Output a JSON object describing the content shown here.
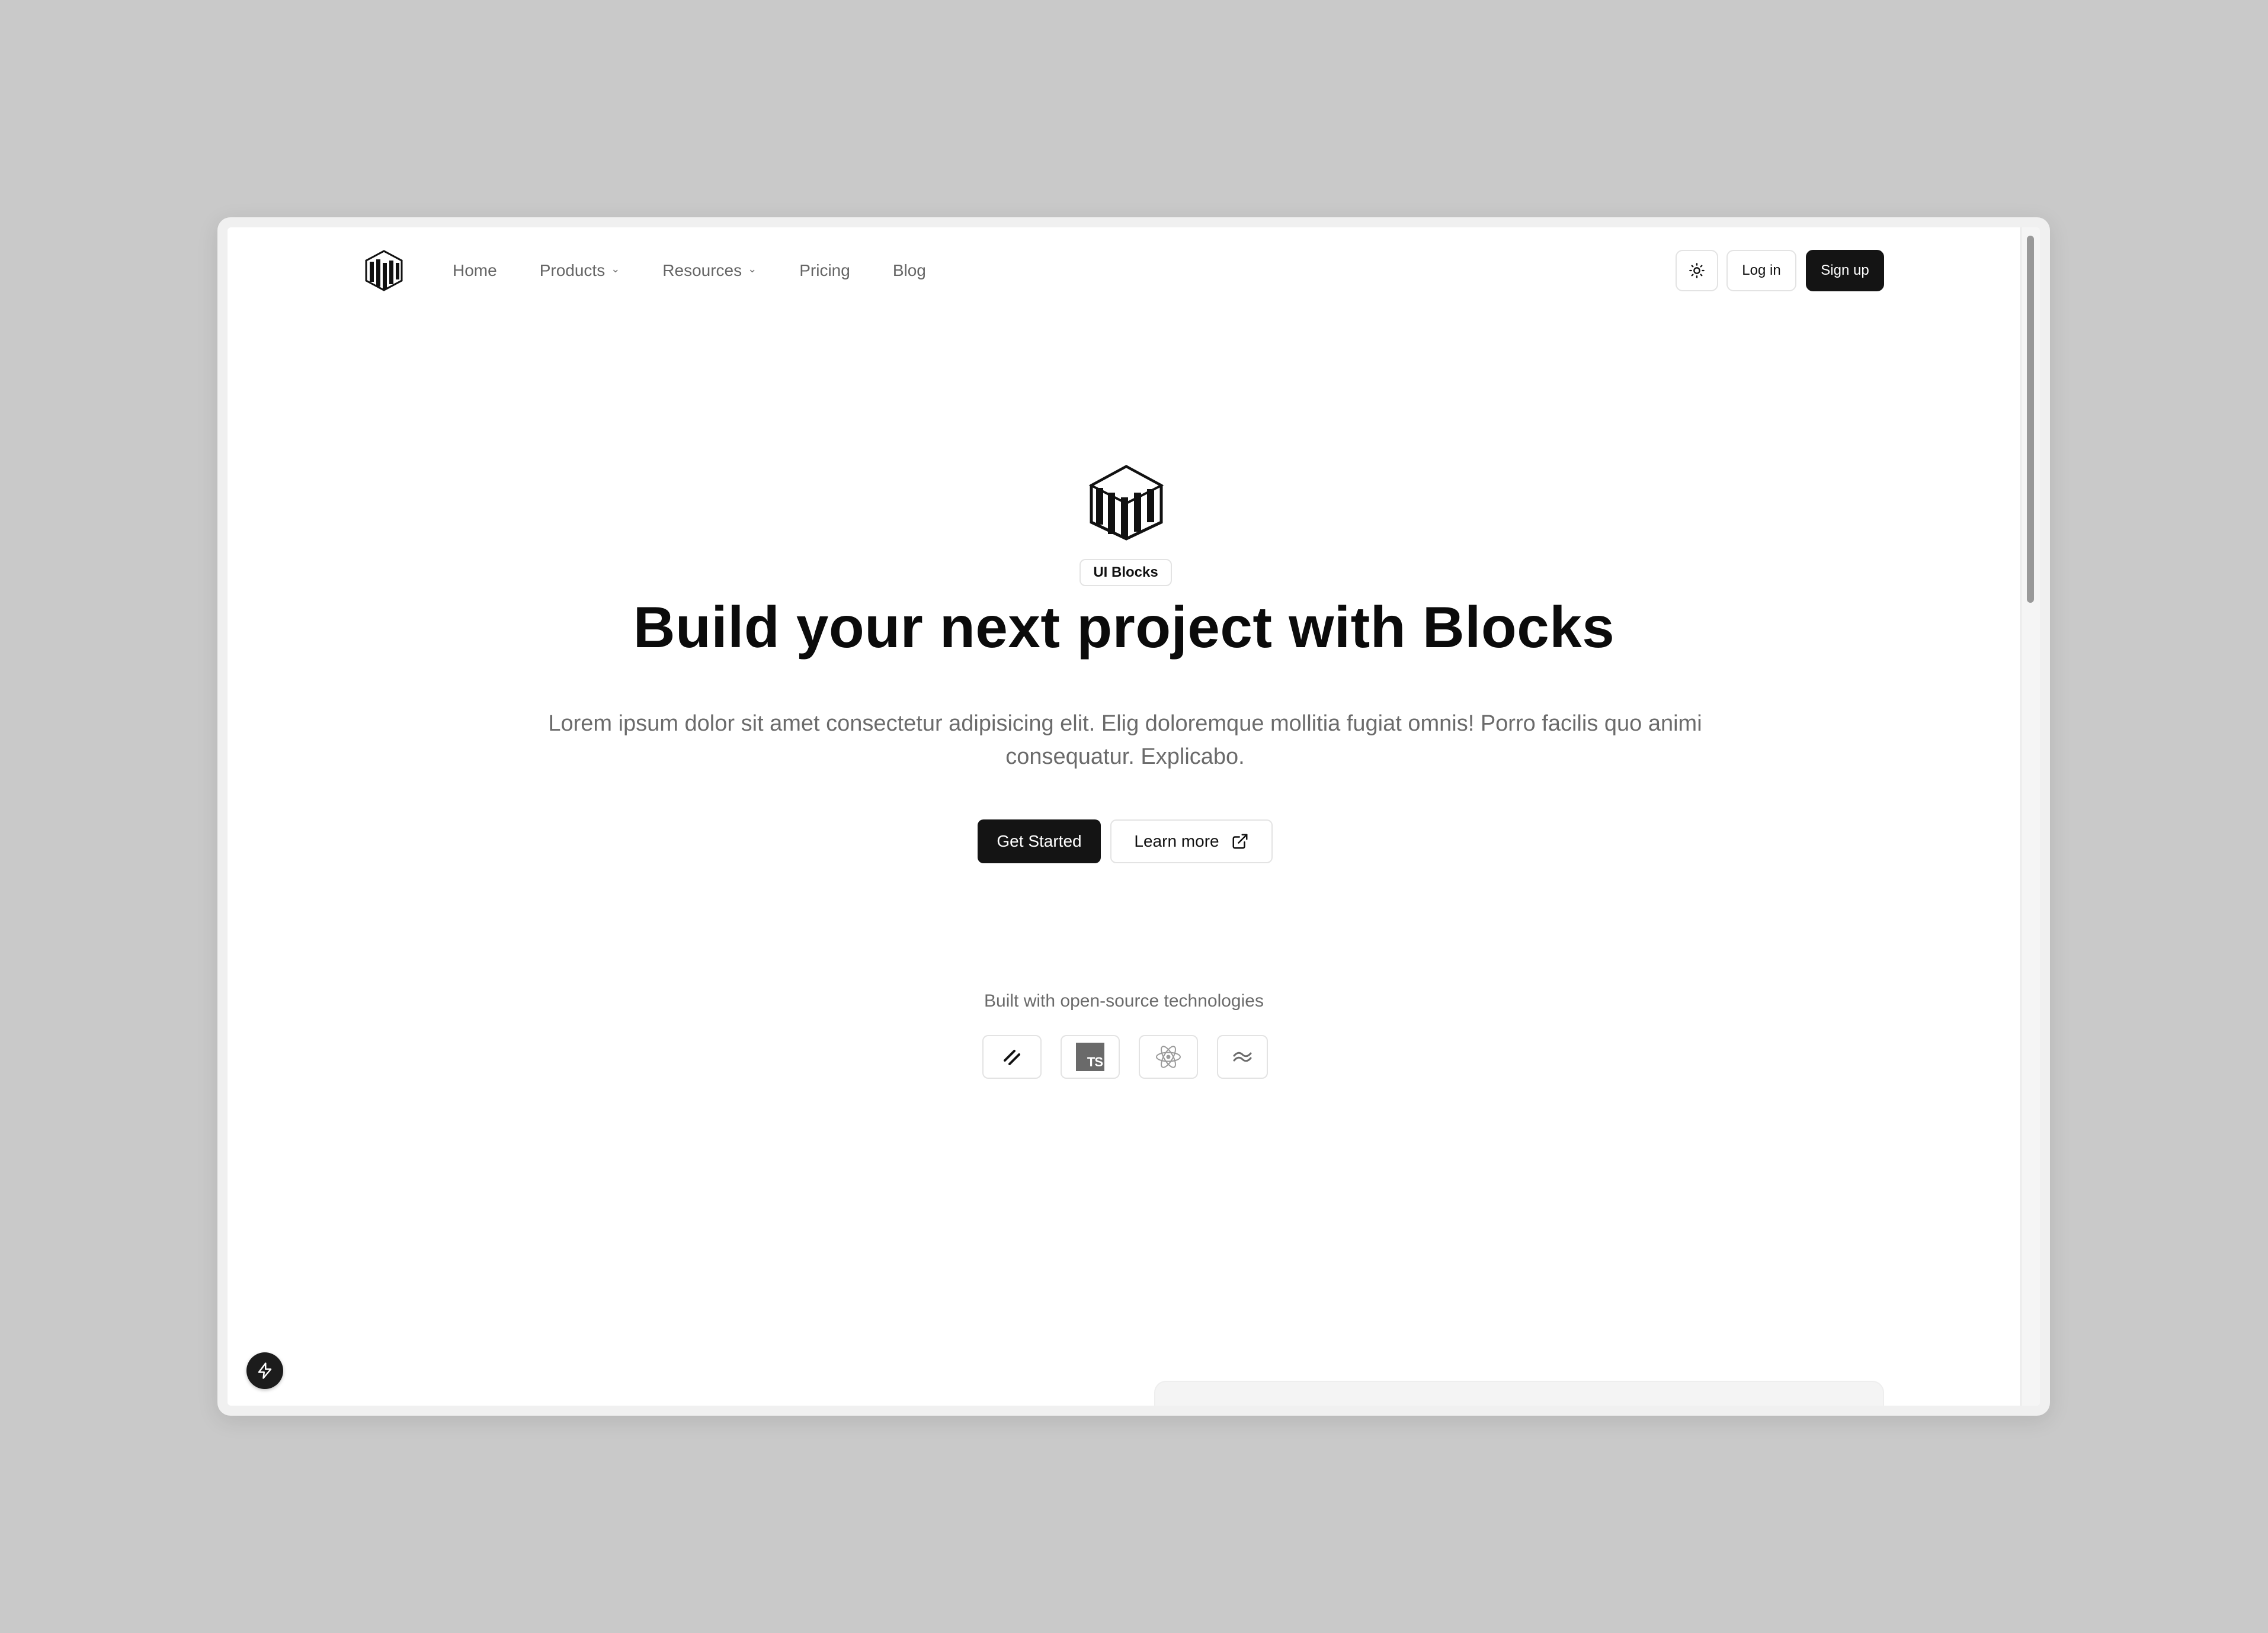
{
  "nav": {
    "items": [
      {
        "label": "Home",
        "has_dropdown": false
      },
      {
        "label": "Products",
        "has_dropdown": true
      },
      {
        "label": "Resources",
        "has_dropdown": true
      },
      {
        "label": "Pricing",
        "has_dropdown": false
      },
      {
        "label": "Blog",
        "has_dropdown": false
      }
    ],
    "theme_toggle_icon": "sun-icon",
    "login_label": "Log in",
    "signup_label": "Sign up"
  },
  "hero": {
    "badge": "UI Blocks",
    "title": "Build your next project with Blocks",
    "subtitle": "Lorem ipsum dolor sit amet consectetur adipisicing elit. Elig doloremque mollitia fugiat omnis! Porro facilis quo animi consequatur. Explicabo.",
    "primary_cta": "Get Started",
    "secondary_cta": "Learn more",
    "secondary_cta_icon": "external-link-icon"
  },
  "tech": {
    "caption": "Built with open-source technologies",
    "ts_label": "TS",
    "items": [
      "shadcn-icon",
      "typescript-icon",
      "react-icon",
      "tailwind-icon"
    ]
  },
  "colors": {
    "primary": "#141414",
    "muted_text": "#6b6b6b",
    "border": "#e3e3e3",
    "background": "#ffffff",
    "canvas": "#c9c9c9"
  }
}
